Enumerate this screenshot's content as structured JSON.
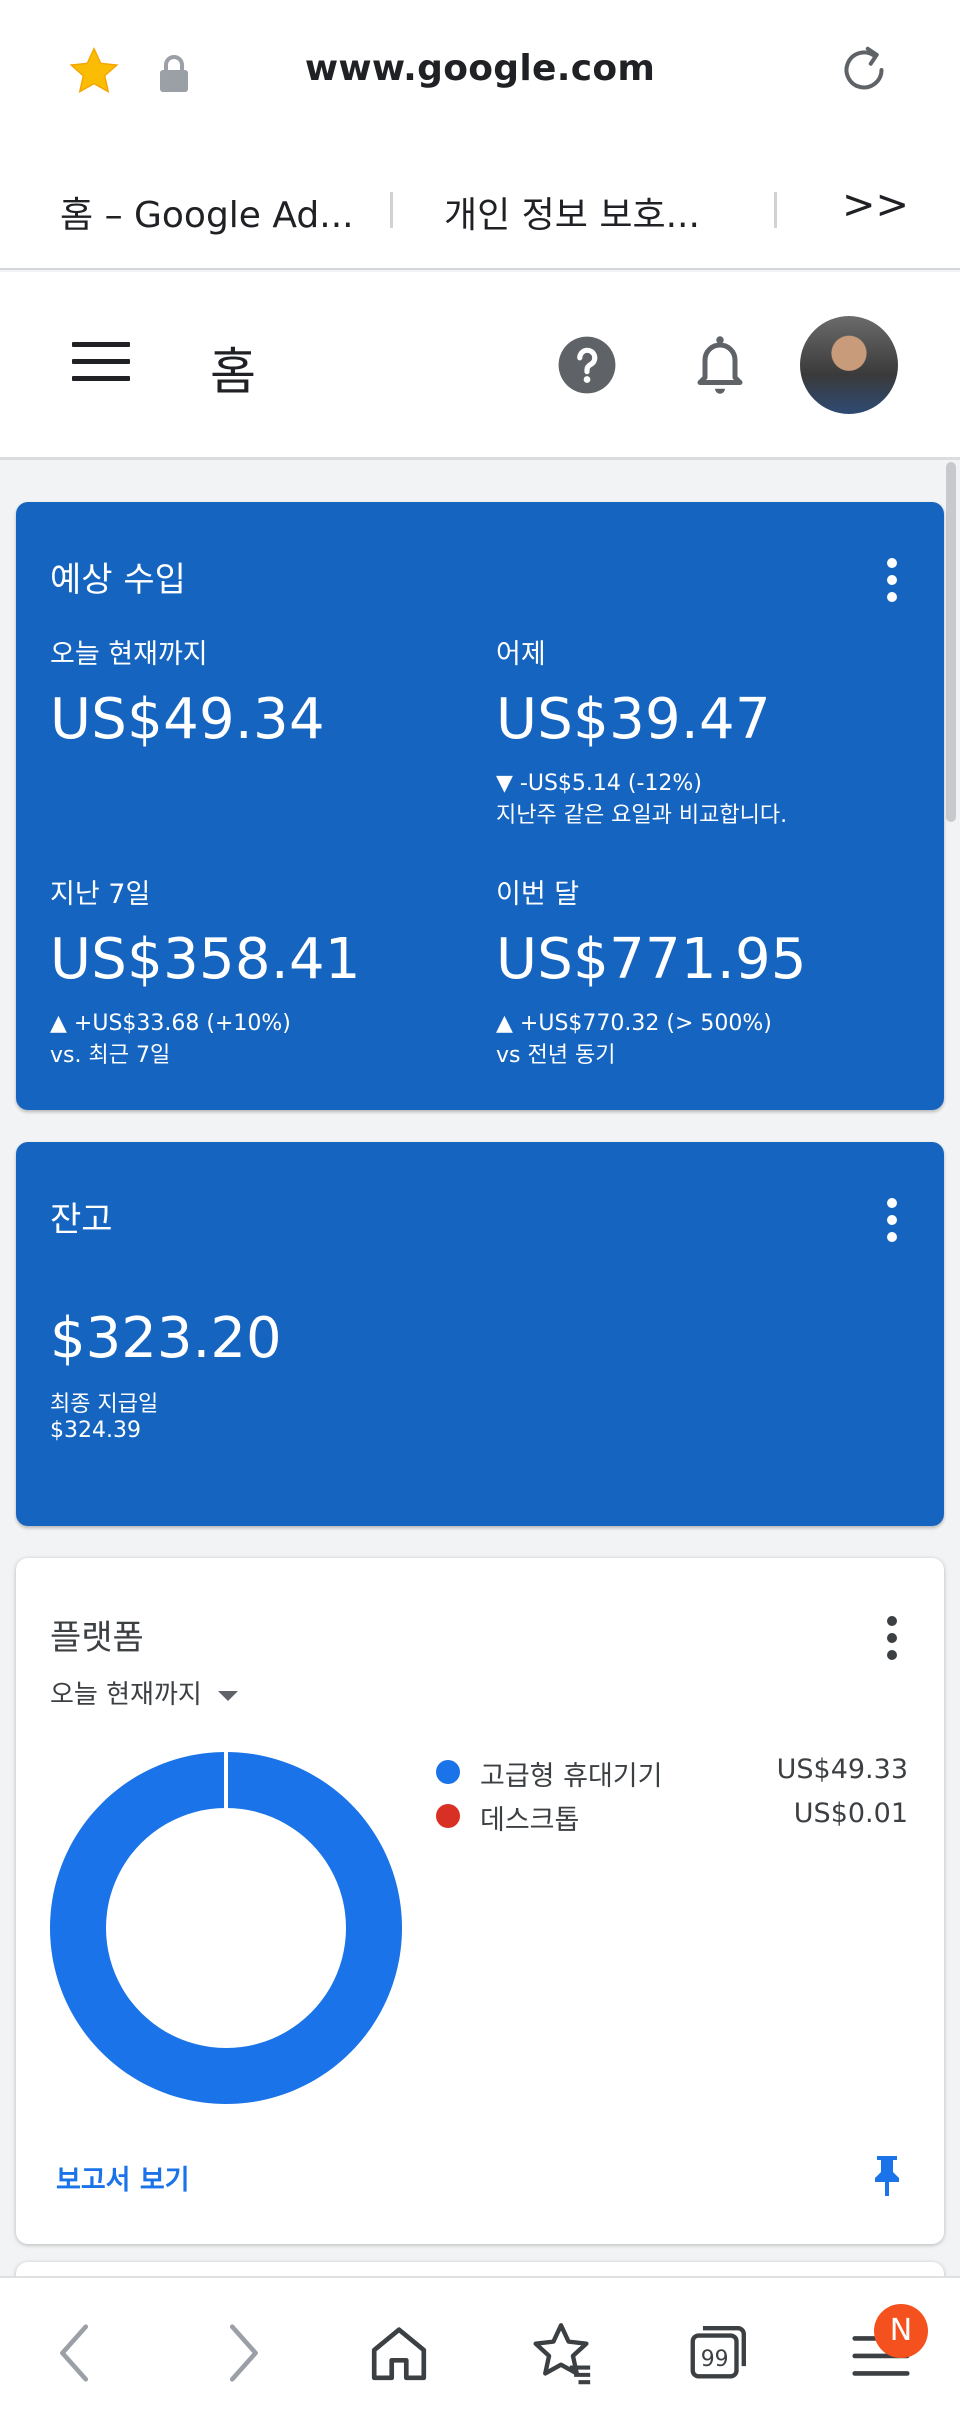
{
  "browser": {
    "url": "www.google.com",
    "tabs": [
      "홈 – Google Ad...",
      "개인 정보 보호..."
    ],
    "tabs_more": ">>",
    "nav_badge": "N"
  },
  "appbar": {
    "title": "홈"
  },
  "earnings": {
    "title": "예상 수입",
    "today_label": "오늘 현재까지",
    "today_value": "US$49.34",
    "yesterday_label": "어제",
    "yesterday_value": "US$39.47",
    "yesterday_change": "▼ -US$5.14 (-12%)",
    "yesterday_note": "지난주 같은 요일과 비교합니다.",
    "last7_label": "지난 7일",
    "last7_value": "US$358.41",
    "last7_change": "▲ +US$33.68 (+10%)",
    "last7_note": "vs. 최근 7일",
    "month_label": "이번 달",
    "month_value": "US$771.95",
    "month_change": "▲ +US$770.32 (> 500%)",
    "month_note": "vs 전년 동기"
  },
  "balance": {
    "title": "잔고",
    "value": "$323.20",
    "last_payment_label": "최종 지급일",
    "last_payment_value": "$324.39"
  },
  "platform": {
    "title": "플랫폼",
    "range": "오늘 현재까지",
    "report_link": "보고서 보기"
  },
  "chart_data": {
    "type": "pie",
    "categories": [
      "고급형 휴대기기",
      "데스크톱"
    ],
    "values": [
      49.33,
      0.01
    ],
    "value_labels": [
      "US$49.33",
      "US$0.01"
    ],
    "colors": [
      "#1a73e8",
      "#d93025"
    ]
  },
  "colors": {
    "card_blue": "#1565c0",
    "link_blue": "#1a73e8",
    "badge": "#f4511e"
  }
}
